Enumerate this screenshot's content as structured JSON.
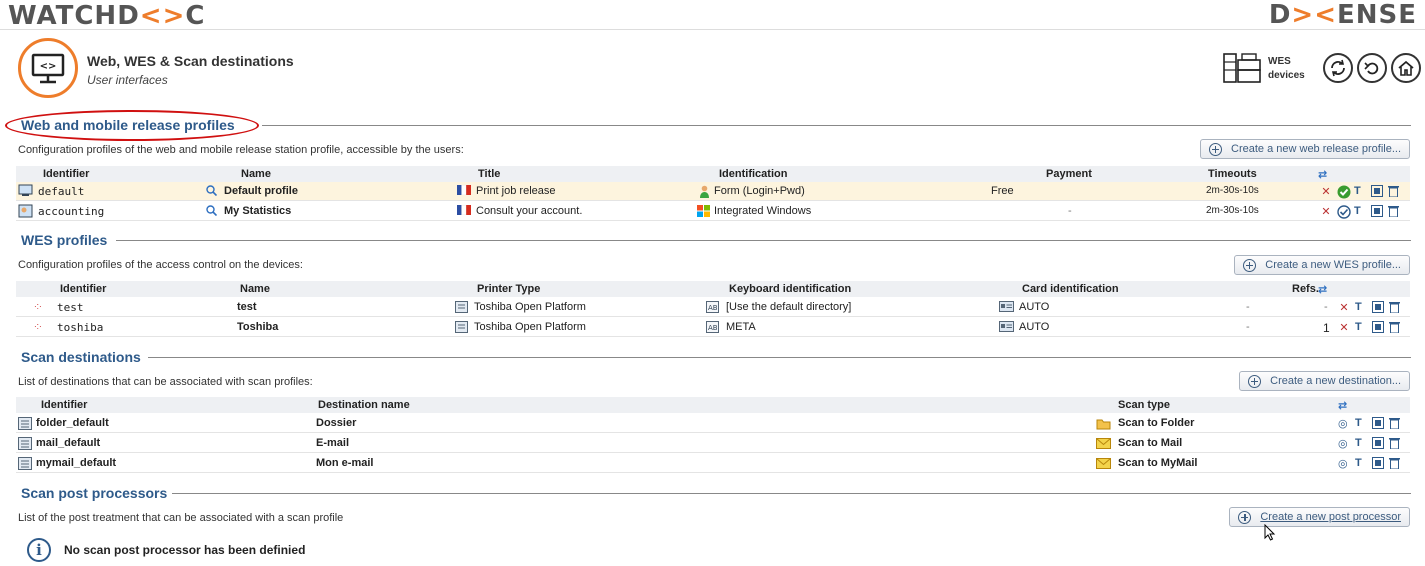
{
  "brand": {
    "left_logo": "WATCHDOC",
    "right_logo": "DOXENSE"
  },
  "header": {
    "title": "Web, WES & Scan destinations",
    "subtitle": "User interfaces",
    "wes_devices_label": "WES devices"
  },
  "icons": {
    "refresh": "refresh-icon",
    "back": "back-icon",
    "home": "home-icon"
  },
  "colors": {
    "accent": "#ee7d2b",
    "section_title": "#2e5a8a",
    "highlight_row": "#fdf4de",
    "annotation": "#d01010"
  },
  "web_profiles": {
    "title": "Web and mobile release profiles",
    "desc": "Configuration profiles of the web and mobile release station profile, accessible by the users:",
    "create_label": "Create a new web release profile...",
    "columns": [
      "Identifier",
      "Name",
      "Title",
      "Identification",
      "Payment",
      "Timeouts"
    ],
    "rows": [
      {
        "identifier": "default",
        "name": "Default profile",
        "title": "Print job release",
        "identification": "Form (Login+Pwd)",
        "payment": "Free",
        "timeouts": "2m-30s-10s"
      },
      {
        "identifier": "accounting",
        "name": "My Statistics",
        "title": "Consult your account.",
        "identification": "Integrated Windows",
        "payment": "-",
        "timeouts": "2m-30s-10s"
      }
    ]
  },
  "wes_profiles": {
    "title": "WES profiles",
    "desc": "Configuration profiles of the access control on the devices:",
    "create_label": "Create a new WES profile...",
    "columns": [
      "Identifier",
      "Name",
      "Printer Type",
      "Keyboard identification",
      "Card identification",
      "Refs."
    ],
    "rows": [
      {
        "identifier": "test",
        "name": "test",
        "printer_type": "Toshiba Open Platform",
        "keyboard": "[Use the default directory]",
        "card": "AUTO",
        "dash": "-",
        "refs": "-"
      },
      {
        "identifier": "toshiba",
        "name": "Toshiba",
        "printer_type": "Toshiba Open Platform",
        "keyboard": "META",
        "card": "AUTO",
        "dash": "-",
        "refs": "1"
      }
    ]
  },
  "scan_destinations": {
    "title": "Scan destinations",
    "desc": "List of destinations that can be associated with scan profiles:",
    "create_label": "Create a new destination...",
    "columns": [
      "Identifier",
      "Destination name",
      "Scan type"
    ],
    "rows": [
      {
        "identifier": "folder_default",
        "name": "Dossier",
        "scan_type": "Scan to Folder"
      },
      {
        "identifier": "mail_default",
        "name": "E-mail",
        "scan_type": "Scan to Mail"
      },
      {
        "identifier": "mymail_default",
        "name": "Mon e-mail",
        "scan_type": "Scan to MyMail"
      }
    ]
  },
  "scan_post": {
    "title": "Scan post processors",
    "desc": "List of the post treatment that can be associated with a scan profile",
    "create_label": "Create a new post processor",
    "empty_message": "No scan post processor has been definied"
  }
}
